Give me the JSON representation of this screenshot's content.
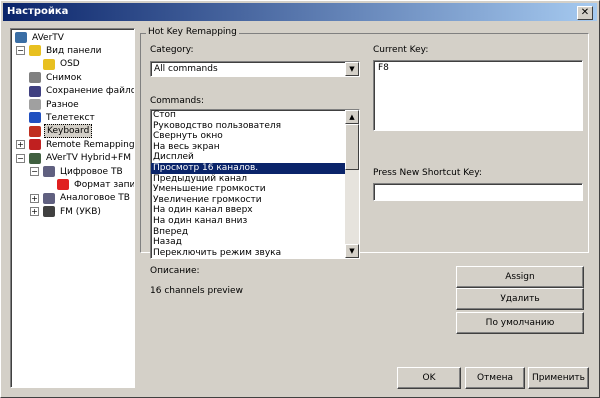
{
  "window": {
    "title": "Настройка",
    "close_glyph": "✕"
  },
  "tree": {
    "items": [
      {
        "label": "AVerTV",
        "icon": "monitor-icon",
        "color": "#3a6ea5"
      },
      {
        "label": "Вид панели",
        "icon": "panel-icon",
        "color": "#e8c020"
      },
      {
        "label": "OSD",
        "icon": "osd-icon",
        "color": "#e8c020"
      },
      {
        "label": "Снимок",
        "icon": "camera-icon",
        "color": "#808080"
      },
      {
        "label": "Сохранение файлов",
        "icon": "floppy-icon",
        "color": "#404080"
      },
      {
        "label": "Разное",
        "icon": "tools-icon",
        "color": "#a0a0a0"
      },
      {
        "label": "Телетекст",
        "icon": "teletext-icon",
        "color": "#2050c0"
      },
      {
        "label": "Keyboard",
        "icon": "keyboard-icon",
        "color": "#c03020"
      },
      {
        "label": "Remote Remapping",
        "icon": "remote-icon",
        "color": "#c02020"
      },
      {
        "label": "AVerTV Hybrid+FM Vo",
        "icon": "card-icon",
        "color": "#406040"
      },
      {
        "label": "Цифровое ТВ",
        "icon": "tv-icon",
        "color": "#606080"
      },
      {
        "label": "Формат запи",
        "icon": "record-icon",
        "color": "#e02020"
      },
      {
        "label": "Аналоговое ТВ",
        "icon": "tv-icon",
        "color": "#606080"
      },
      {
        "label": "FM (УКВ)",
        "icon": "radio-icon",
        "color": "#404040"
      }
    ]
  },
  "group": {
    "title": "Hot Key Remapping"
  },
  "category": {
    "label": "Category:",
    "value": "All commands"
  },
  "commands": {
    "label": "Commands:",
    "items": [
      "Стоп",
      "Руководство пользователя",
      "Свернуть окно",
      "На весь экран",
      "Дисплей",
      "Просмотр 16 каналов.",
      "Предыдущий канал",
      "Уменьшение громкости",
      "Увеличение громкости",
      "На один канал вверх",
      "На один канал вниз",
      "Вперед",
      "Назад",
      "Переключить режим звука"
    ],
    "selected_index": 5
  },
  "current_key": {
    "label": "Current Key:",
    "value": "F8"
  },
  "new_shortcut": {
    "label": "Press New Shortcut Key:",
    "value": ""
  },
  "description": {
    "label": "Описание:",
    "text": "16 channels preview"
  },
  "buttons": {
    "assign": "Assign",
    "delete": "Удалить",
    "default": "По умолчанию",
    "ok": "OK",
    "cancel": "Отмена",
    "apply": "Применить"
  }
}
